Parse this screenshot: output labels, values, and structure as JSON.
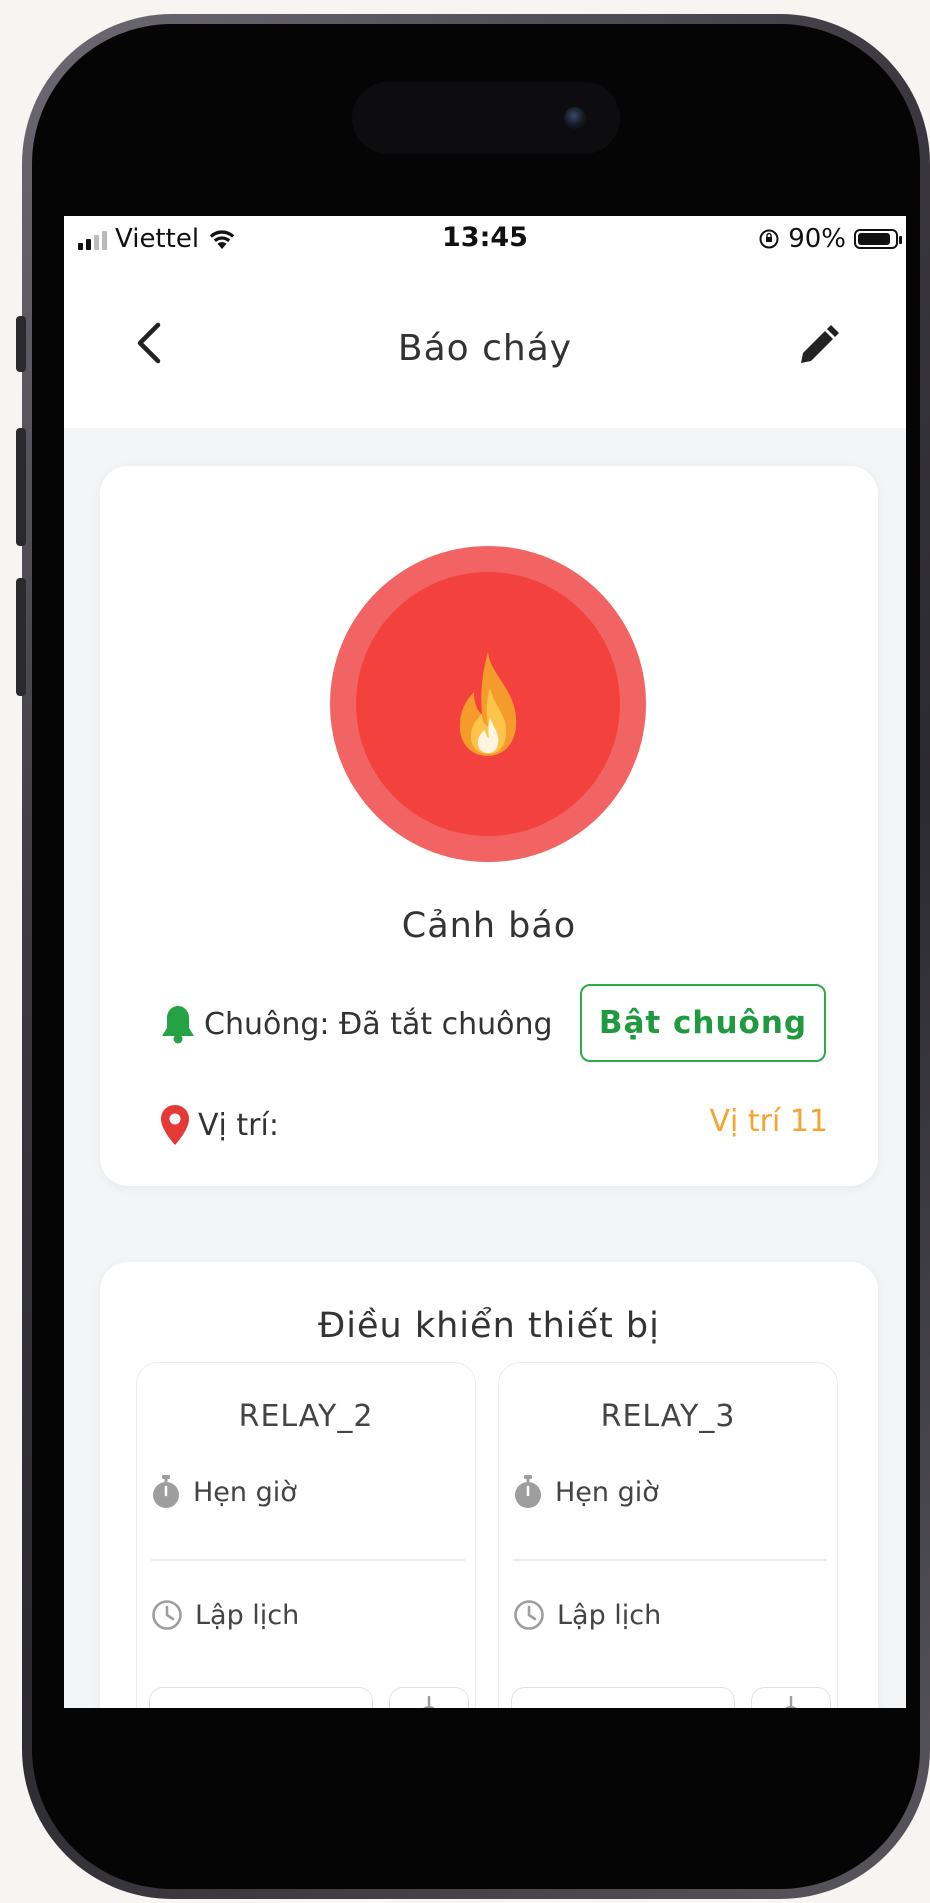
{
  "status_bar": {
    "carrier": "Viettel",
    "time": "13:45",
    "battery": "90%",
    "battery_level": 0.9
  },
  "header": {
    "title": "Báo cháy",
    "back_icon": "chevron-left-icon",
    "edit_icon": "pencil-icon"
  },
  "alert": {
    "status": "Cảnh báo",
    "bell_label": "Chuông: Đã tắt chuông",
    "bell_button": "Bật chuông",
    "location_label": "Vị trí:",
    "location_value": "Vị trí 11",
    "icons": [
      "fire-icon",
      "bell-icon",
      "location-pin-icon"
    ]
  },
  "device_control": {
    "title": "Điều khiển thiết bị",
    "relays": [
      {
        "name": "RELAY_2",
        "timer_label": "Hẹn giờ",
        "schedule_label": "Lập lịch"
      },
      {
        "name": "RELAY_3",
        "timer_label": "Hẹn giờ",
        "schedule_label": "Lập lịch"
      }
    ]
  },
  "colors": {
    "alarm_outer": "#f26363",
    "alarm_inner": "#f3423d",
    "bell_green": "#2eaa4d",
    "location_orange": "#f5a331",
    "pin_red": "#e53935"
  }
}
